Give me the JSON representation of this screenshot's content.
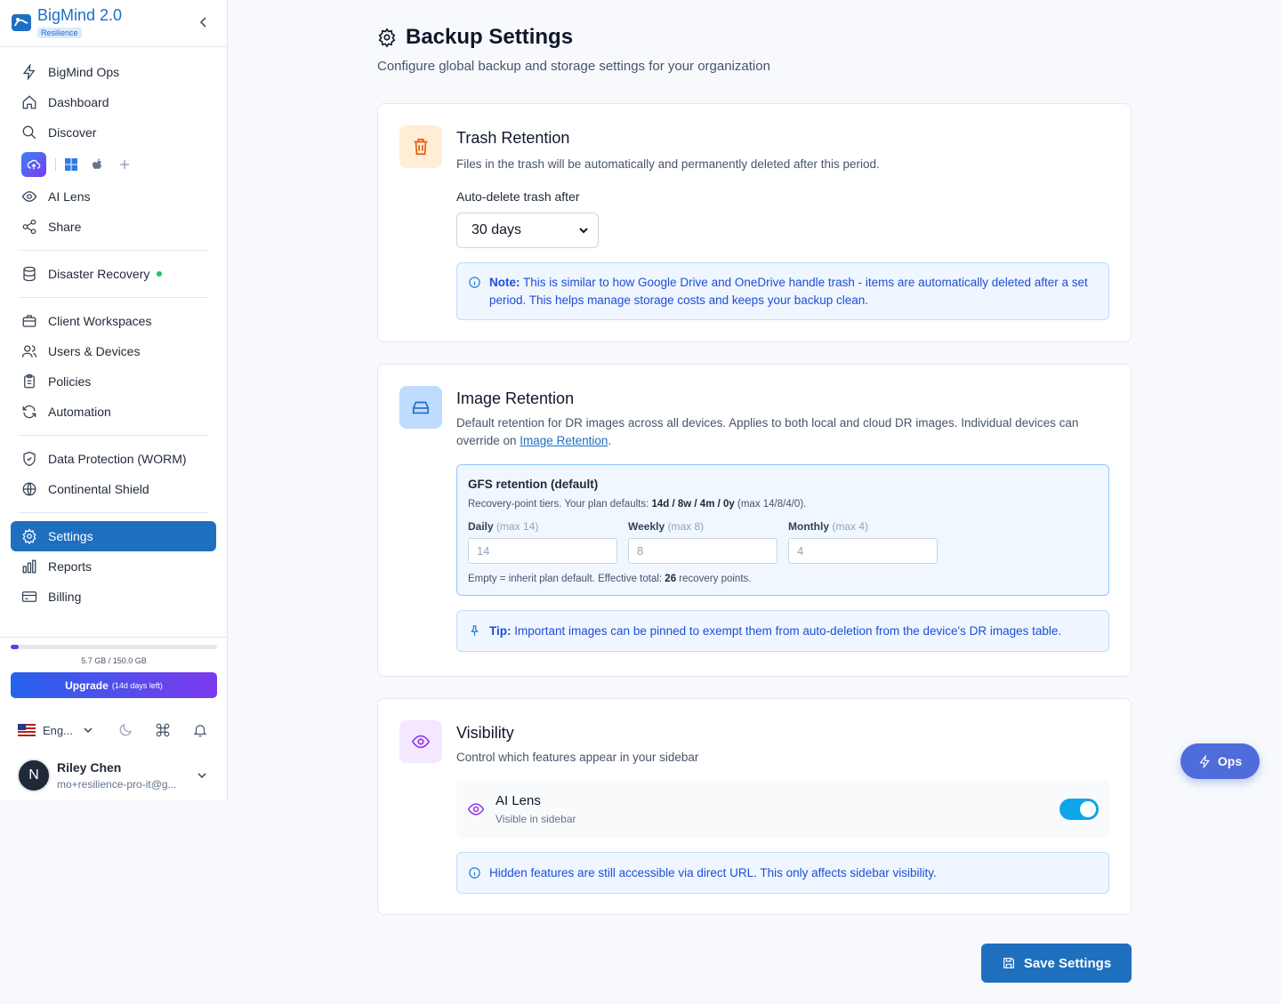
{
  "app": {
    "name": "BigMind 2.0",
    "badge": "Resilience"
  },
  "sidebar": {
    "group1": [
      {
        "label": "BigMind Ops",
        "icon": "bolt-icon"
      },
      {
        "label": "Dashboard",
        "icon": "home-icon"
      },
      {
        "label": "Discover",
        "icon": "search-icon"
      }
    ],
    "group1b": [
      {
        "label": "AI Lens",
        "icon": "eye-icon"
      },
      {
        "label": "Share",
        "icon": "share-icon"
      }
    ],
    "disaster_recovery": {
      "label": "Disaster Recovery",
      "icon": "database-icon",
      "status_color": "#22c55e"
    },
    "group2": [
      {
        "label": "Client Workspaces",
        "icon": "briefcase-icon"
      },
      {
        "label": "Users & Devices",
        "icon": "users-icon"
      },
      {
        "label": "Policies",
        "icon": "clipboard-icon"
      },
      {
        "label": "Automation",
        "icon": "refresh-icon"
      }
    ],
    "group3": [
      {
        "label": "Data Protection (WORM)",
        "icon": "shield-icon"
      },
      {
        "label": "Continental Shield",
        "icon": "globe-icon"
      }
    ],
    "group4": [
      {
        "label": "Settings",
        "icon": "gear-icon",
        "active": true
      },
      {
        "label": "Reports",
        "icon": "bar-chart-icon"
      },
      {
        "label": "Billing",
        "icon": "credit-card-icon"
      }
    ],
    "storage": {
      "text": "5.7 GB / 150.0 GB",
      "fraction": 0.038
    },
    "upgrade": {
      "label": "Upgrade",
      "sub": "(14d days left)"
    },
    "language": "Eng...",
    "user": {
      "initial": "N",
      "name": "Riley Chen",
      "email": "mo+resilience-pro-it@g..."
    }
  },
  "page": {
    "title": "Backup Settings",
    "subtitle": "Configure global backup and storage settings for your organization"
  },
  "trash": {
    "title": "Trash Retention",
    "desc": "Files in the trash will be automatically and permanently deleted after this period.",
    "field_label": "Auto-delete trash after",
    "selected": "30 days",
    "note_bold": "Note:",
    "note_text": " This is similar to how Google Drive and OneDrive handle trash - items are automatically deleted after a set period. This helps manage storage costs and keeps your backup clean."
  },
  "image": {
    "title": "Image Retention",
    "desc": "Default retention for DR images across all devices. Applies to both local and cloud DR images. Individual devices can override on ",
    "desc_link": "Image Retention",
    "desc_end": ".",
    "gfs_title": "GFS retention (default)",
    "gfs_sub_a": "Recovery-point tiers. Your plan defaults: ",
    "gfs_sub_b": "14d / 8w / 4m / 0y",
    "gfs_sub_c": " (max 14/8/4/0).",
    "fields": [
      {
        "label": "Daily",
        "max": "(max 14)",
        "placeholder": "14"
      },
      {
        "label": "Weekly",
        "max": "(max 8)",
        "placeholder": "8"
      },
      {
        "label": "Monthly",
        "max": "(max 4)",
        "placeholder": "4"
      }
    ],
    "foot_a": "Empty = inherit plan default. Effective total: ",
    "foot_b": "26",
    "foot_c": " recovery points.",
    "tip_bold": "Tip:",
    "tip_text": " Important images can be pinned to exempt them from auto-deletion from the device's DR images table."
  },
  "visibility": {
    "title": "Visibility",
    "desc": "Control which features appear in your sidebar",
    "item_title": "AI Lens",
    "item_sub": "Visible in sidebar",
    "toggle_on": true,
    "note": "Hidden features are still accessible via direct URL. This only affects sidebar visibility."
  },
  "ops_button": "Ops",
  "save_button": "Save Settings"
}
